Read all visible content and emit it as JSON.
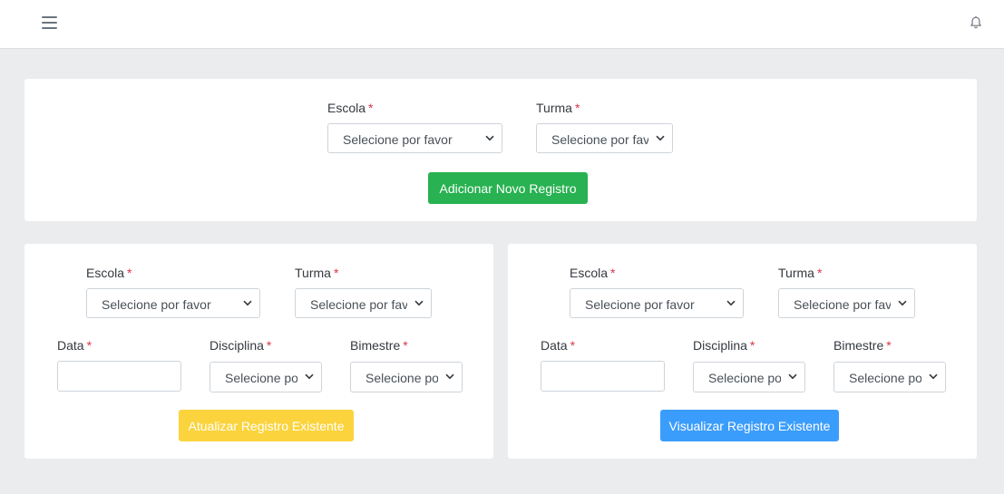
{
  "topbar": {
    "menu_icon": "hamburger-icon",
    "notification_icon": "bell-icon"
  },
  "add_form": {
    "escola": {
      "label": "Escola",
      "required": "*",
      "placeholder": "Selecione por favor"
    },
    "turma": {
      "label": "Turma",
      "required": "*",
      "placeholder": "Selecione por favor"
    },
    "submit_label": "Adicionar Novo Registro"
  },
  "update_form": {
    "escola": {
      "label": "Escola",
      "required": "*",
      "placeholder": "Selecione por favor"
    },
    "turma": {
      "label": "Turma",
      "required": "*",
      "placeholder": "Selecione por favor"
    },
    "data": {
      "label": "Data",
      "required": "*",
      "value": ""
    },
    "disciplina": {
      "label": "Disciplina",
      "required": "*",
      "placeholder": "Selecione por favor"
    },
    "bimestre": {
      "label": "Bimestre",
      "required": "*",
      "placeholder": "Selecione por favor"
    },
    "submit_label": "Atualizar Registro Existente"
  },
  "view_form": {
    "escola": {
      "label": "Escola",
      "required": "*",
      "placeholder": "Selecione por favor"
    },
    "turma": {
      "label": "Turma",
      "required": "*",
      "placeholder": "Selecione por favor"
    },
    "data": {
      "label": "Data",
      "required": "*",
      "value": ""
    },
    "disciplina": {
      "label": "Disciplina",
      "required": "*",
      "placeholder": "Selecione por favor"
    },
    "bimestre": {
      "label": "Bimestre",
      "required": "*",
      "placeholder": "Selecione por favor"
    },
    "submit_label": "Visualizar Registro Existente"
  },
  "colors": {
    "page_bg": "#ebecee",
    "required": "#dc3545",
    "add_button": "#28b251",
    "update_button": "#fbd33c",
    "view_button": "#3b9dfb"
  }
}
